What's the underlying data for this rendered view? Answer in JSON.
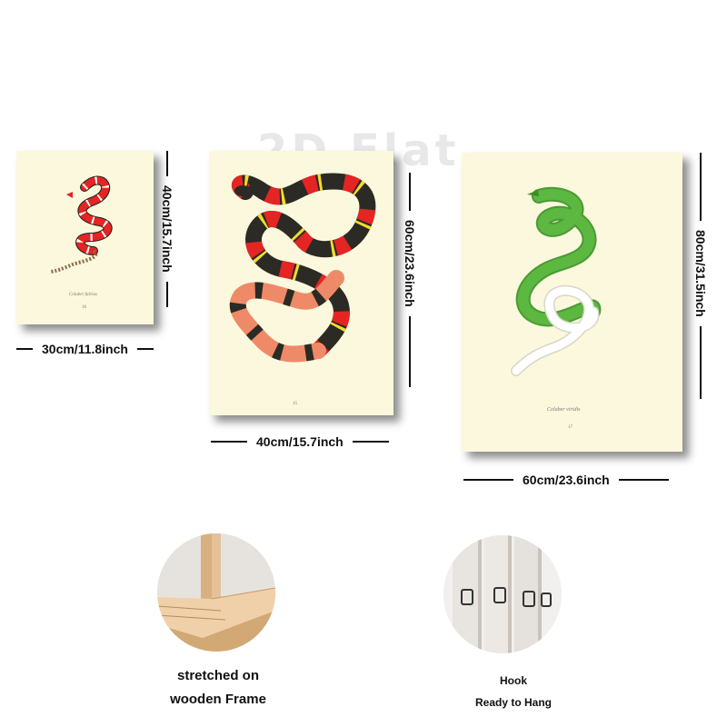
{
  "watermark": "2D Flat",
  "canvases": [
    {
      "width_label": "30cm/11.8inch",
      "height_label": "40cm/15.7inch",
      "caption": "Coluber fulvius",
      "plate": "16"
    },
    {
      "width_label": "40cm/15.7inch",
      "height_label": "60cm/23.6inch",
      "caption": "",
      "plate": "15"
    },
    {
      "width_label": "60cm/23.6inch",
      "height_label": "80cm/31.5inch",
      "caption": "Coluber viridis",
      "plate": "17"
    }
  ],
  "features": [
    {
      "line1": "stretched on",
      "line2": "wooden Frame",
      "icon": "wooden-frame-corner"
    },
    {
      "line1": "Hook",
      "line2": "Ready to Hang",
      "icon": "hanging-hook"
    }
  ],
  "colors": {
    "canvas_bg": "#fbf8dd",
    "coral_red": "#e52424",
    "coral_black": "#2b2a24",
    "coral_yellow": "#f3dc2c",
    "coral_salmon": "#ef8a68",
    "green_snake": "#5cb841"
  }
}
